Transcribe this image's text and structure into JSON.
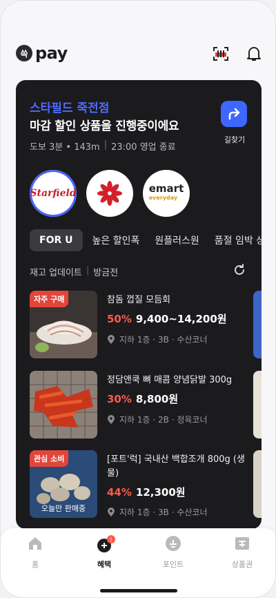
{
  "header": {
    "logo_mark": "쓱",
    "logo_text": "pay"
  },
  "store": {
    "name": "스타필드 죽전점",
    "title": "마감 할인 상품을 진행중이에요",
    "distance": "도보 3분 • 143m",
    "hours": "23:00 영업 종료",
    "route_label": "길찾기"
  },
  "brands": [
    {
      "name": "Starfield",
      "selected": true
    },
    {
      "name": "신세계",
      "selected": false
    },
    {
      "name": "emart",
      "sub": "everyday",
      "selected": false
    }
  ],
  "tabs": [
    "FOR U",
    "높은 할인폭",
    "원플러스원",
    "품절 임박 상"
  ],
  "stock": {
    "label": "재고 업데이트",
    "time": "방금전"
  },
  "items": [
    {
      "badge": "자주 구매",
      "name": "참돔 껍질 모듬회",
      "discount": "50%",
      "price": "9,400~14,200원",
      "location": "지하 1층 · 3B · 수산코너",
      "caption": ""
    },
    {
      "badge": "",
      "name": "정담앤쿡 뼈 매콤 양념닭발 300g",
      "discount": "30%",
      "price": "8,800원",
      "location": "지하 1층 · 2B · 정육코너",
      "caption": ""
    },
    {
      "badge": "관심 소비",
      "name": "[포트'럭] 국내산 백합조개 800g (생물)",
      "discount": "44%",
      "price": "12,300원",
      "location": "지하 1층 · 3B · 수산코너",
      "caption": "오늘만 판매중"
    }
  ],
  "nav": [
    {
      "label": "홈",
      "icon": "home-icon",
      "active": false
    },
    {
      "label": "혜택",
      "icon": "benefit-icon",
      "active": true
    },
    {
      "label": "포인트",
      "icon": "point-icon",
      "active": false
    },
    {
      "label": "상품권",
      "icon": "giftcard-icon",
      "active": false
    }
  ],
  "colors": {
    "accent": "#3d67ff",
    "discount": "#ff5a4c",
    "badge": "#e2463b",
    "card_bg": "#1b1b1e"
  }
}
